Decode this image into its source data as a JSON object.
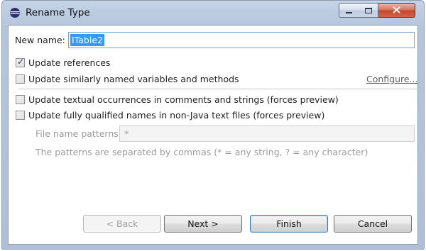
{
  "window": {
    "title": "Rename Type"
  },
  "new_name": {
    "label": "New name:",
    "value": "ITable2"
  },
  "options": {
    "update_references": {
      "label": "Update references",
      "checked": true
    },
    "update_similar": {
      "label": "Update similarly named variables and methods",
      "checked": false
    },
    "configure_link": "Configure...",
    "update_textual": {
      "label": "Update textual occurrences in comments and strings (forces preview)",
      "checked": false
    },
    "update_qualified": {
      "label": "Update fully qualified names in non-Java text files (forces preview)",
      "checked": false
    }
  },
  "file_patterns": {
    "label": "File name patterns:",
    "value": "*",
    "hint": "The patterns are separated by commas (* = any string, ? = any character)"
  },
  "buttons": {
    "back": "< Back",
    "next": "Next >",
    "finish": "Finish",
    "cancel": "Cancel"
  }
}
